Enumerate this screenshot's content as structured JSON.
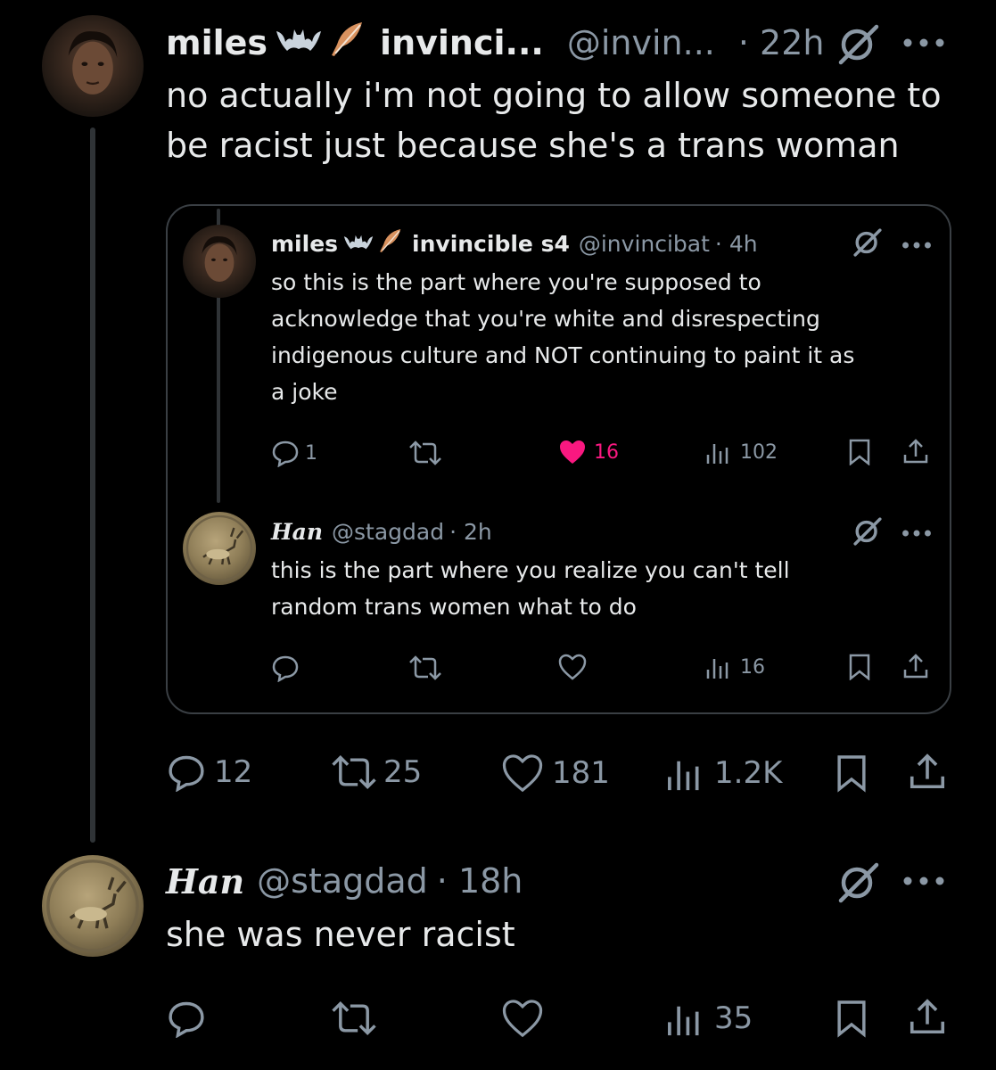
{
  "main_tweet": {
    "display_name": "miles",
    "emoji_badges": [
      "bat-icon",
      "feather-icon"
    ],
    "secondary_name": "invinci...",
    "handle": "@invin...",
    "time": "· 22h",
    "text_line1": "no actually i'm not going to allow someone to",
    "text_line2": "be racist just because she's a trans woman",
    "actions": {
      "replies": "12",
      "retweets": "25",
      "likes": "181",
      "views": "1.2K"
    }
  },
  "quoted_tweet": {
    "display_name": "miles",
    "secondary_name": "invincible s4",
    "handle": "@invincibat",
    "time": "· 4h",
    "text_line1": "so this is the part where you're supposed to",
    "text_line2": "acknowledge that you're white and disrespecting",
    "text_line3": "indigenous culture and NOT continuing to paint it as",
    "text_line4": "a joke",
    "actions": {
      "replies": "1",
      "retweets": "",
      "likes": "16",
      "views": "102"
    }
  },
  "quoted_reply": {
    "display_name": "Han",
    "handle": "@stagdad",
    "time": "· 2h",
    "text_line1": "this is the part where you realize you can't tell",
    "text_line2": "random trans women what to do",
    "actions": {
      "views": "16"
    }
  },
  "reply_tweet": {
    "display_name": "Han",
    "handle": "@stagdad",
    "time": "· 18h",
    "text": "she was never racist",
    "actions": {
      "views": "35"
    }
  },
  "colors": {
    "background": "#000000",
    "text": "#e7e9ea",
    "muted": "#8b98a5",
    "like_active": "#f91880",
    "border": "#3a3f44"
  }
}
